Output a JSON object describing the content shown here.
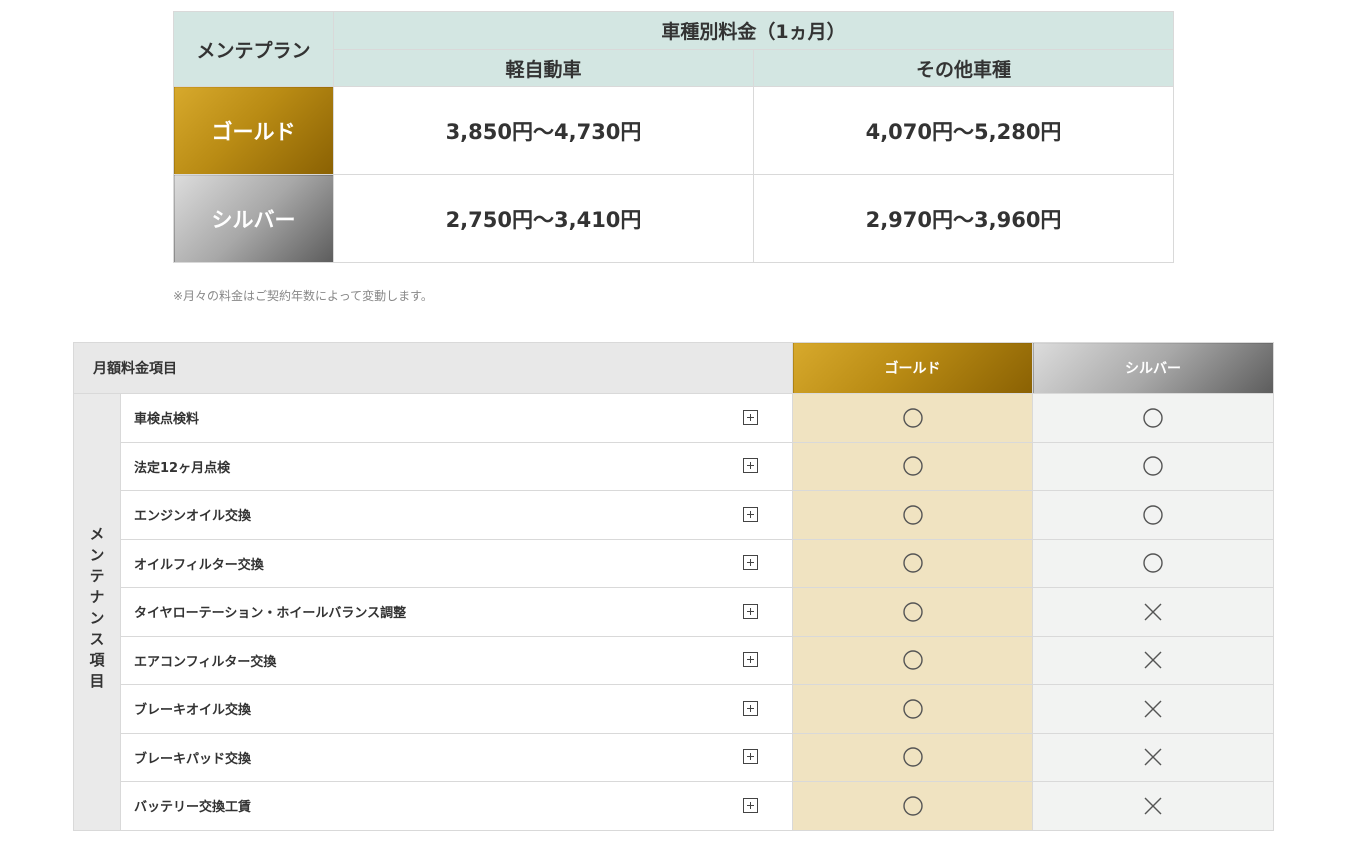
{
  "price_table": {
    "plan_header": "メンテプラン",
    "fee_header": "車種別料金（1ヵ月）",
    "vehicle_types": [
      "軽自動車",
      "その他車種"
    ],
    "plans": [
      {
        "name": "ゴールド",
        "kei": "3,850円～4,730円",
        "other": "4,070円～5,280円"
      },
      {
        "name": "シルバー",
        "kei": "2,750円～3,410円",
        "other": "2,970円～3,960円"
      }
    ],
    "note": "※月々の料金はご契約年数によって変動します。"
  },
  "feature_table": {
    "header_label": "月額料金項目",
    "gold_label": "ゴールド",
    "silver_label": "シルバー",
    "category_label": "メンテナンス項目",
    "items": [
      {
        "label": "車検点検料",
        "gold": "circle",
        "silver": "circle"
      },
      {
        "label": "法定12ヶ月点検",
        "gold": "circle",
        "silver": "circle"
      },
      {
        "label": "エンジンオイル交換",
        "gold": "circle",
        "silver": "circle"
      },
      {
        "label": "オイルフィルター交換",
        "gold": "circle",
        "silver": "circle"
      },
      {
        "label": "タイヤローテーション・ホイールバランス調整",
        "gold": "circle",
        "silver": "cross"
      },
      {
        "label": "エアコンフィルター交換",
        "gold": "circle",
        "silver": "cross"
      },
      {
        "label": "ブレーキオイル交換",
        "gold": "circle",
        "silver": "cross"
      },
      {
        "label": "ブレーキパッド交換",
        "gold": "circle",
        "silver": "cross"
      },
      {
        "label": "バッテリー交換工賃",
        "gold": "circle",
        "silver": "cross"
      }
    ]
  }
}
